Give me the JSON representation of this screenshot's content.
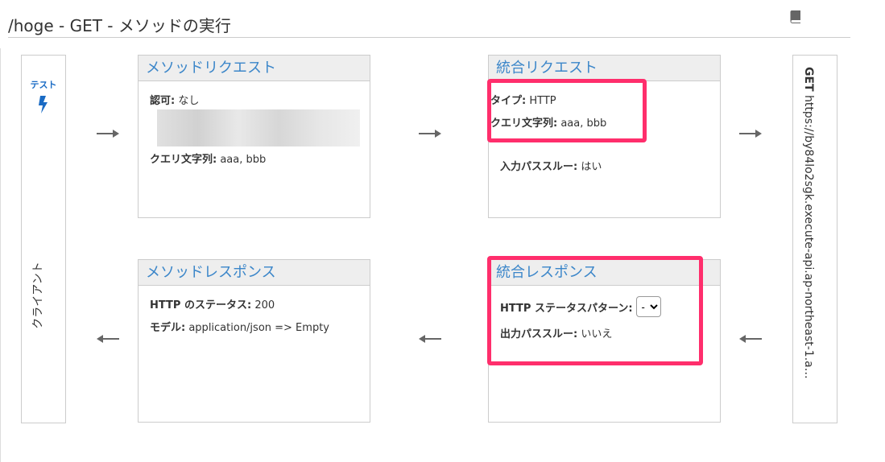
{
  "title": "/hoge - GET - メソッドの実行",
  "client": {
    "test_label": "テスト",
    "label": "クライアント"
  },
  "endpoint": {
    "method": "GET",
    "url": "https://by84lo2sgk.execute-api.ap-northeast-1.a…"
  },
  "method_request": {
    "title": "メソッドリクエスト",
    "auth_label": "認可:",
    "auth_value": "なし",
    "query_label": "クエリ文字列:",
    "query_value": "aaa, bbb"
  },
  "integration_request": {
    "title": "統合リクエスト",
    "type_label": "タイプ:",
    "type_value": "HTTP",
    "query_label": "クエリ文字列:",
    "query_value": "aaa, bbb",
    "passthrough_label": "入力パススルー:",
    "passthrough_value": "はい"
  },
  "method_response": {
    "title": "メソッドレスポンス",
    "status_label": "HTTP のステータス:",
    "status_value": "200",
    "model_label": "モデル:",
    "model_value": "application/json => Empty"
  },
  "integration_response": {
    "title": "統合レスポンス",
    "pattern_label": "HTTP ステータスパターン:",
    "pattern_value": "-",
    "passthrough_label": "出力パススルー:",
    "passthrough_value": "いいえ"
  },
  "colors": {
    "accent": "#3b86c9",
    "highlight": "#ff2e6c"
  }
}
